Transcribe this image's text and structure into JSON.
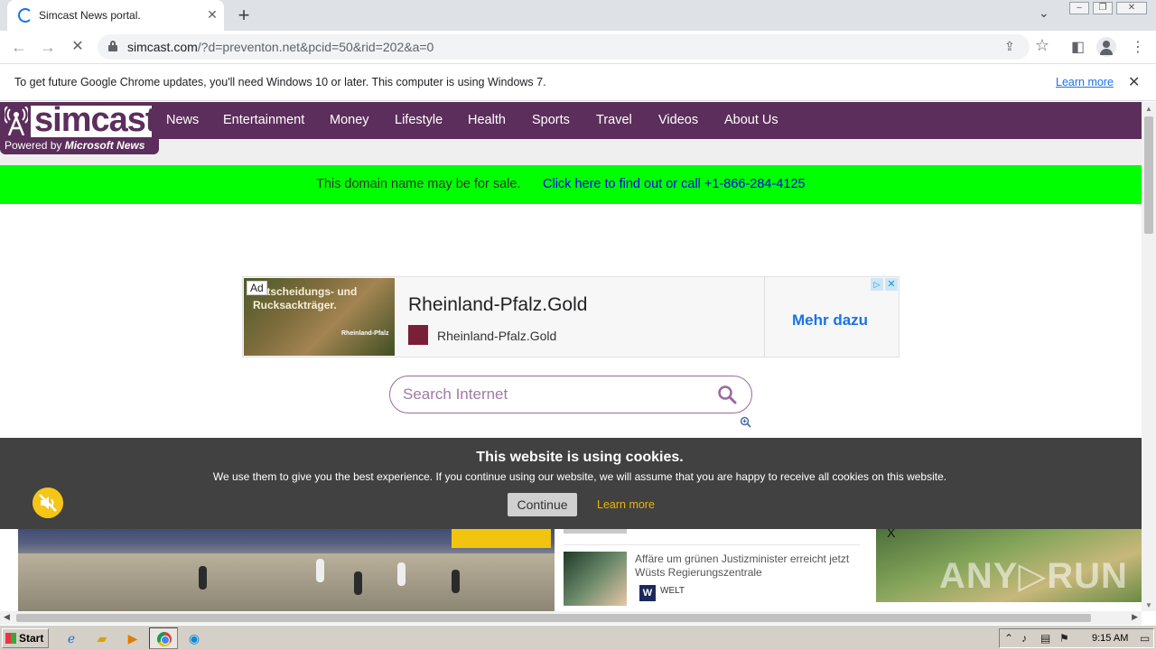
{
  "browser": {
    "tab_title": "Simcast News portal.",
    "tab_close": "✕",
    "new_tab": "+",
    "url_host": "simcast.com",
    "url_path": "/?d=preventon.net&pcid=50&rid=202&a=0"
  },
  "infobar": {
    "message": "To get future Google Chrome updates, you'll need Windows 10 or later. This computer is using Windows 7.",
    "learn_more": "Learn more",
    "close": "✕"
  },
  "site": {
    "logo_text": "simcast",
    "powered_prefix": "Powered by ",
    "powered_brand": "Microsoft News",
    "nav": [
      "News",
      "Entertainment",
      "Money",
      "Lifestyle",
      "Health",
      "Sports",
      "Travel",
      "Videos",
      "About Us"
    ],
    "sale_text": "This domain name may be for sale.",
    "sale_link": "Click here to find out or call +1-866-284-4125"
  },
  "ad": {
    "tag": "Ad",
    "image_text": "Entscheidungs- und Rucksackträger.",
    "image_brand": "Rheinland-Pfalz",
    "headline": "Rheinland-Pfalz.Gold",
    "domain": "Rheinland-Pfalz.Gold",
    "cta": "Mehr dazu",
    "adchoices": "▷",
    "close": "✕"
  },
  "search": {
    "placeholder": "Search Internet"
  },
  "cookie": {
    "title": "This website is using cookies.",
    "text": "We use them to give you the best experience. If you continue using our website, we will assume that you are happy to receive all cookies on this website.",
    "continue": "Continue",
    "learn_more": "Learn more"
  },
  "news": {
    "headline": "Affäre um grünen Justizminister erreicht jetzt Wüsts Regierungszentrale",
    "source_logo": "W",
    "source": "WELT"
  },
  "right_ad": {
    "close": "X",
    "watermark": "ANY▷RUN"
  },
  "taskbar": {
    "start": "Start",
    "time": "9:15 AM"
  },
  "colors": {
    "brand_purple": "#5c2e5b",
    "sale_green": "#00ff00",
    "link_blue": "#1a73e8",
    "cookie_bg": "#414141",
    "cookie_learn": "#f0b400"
  }
}
